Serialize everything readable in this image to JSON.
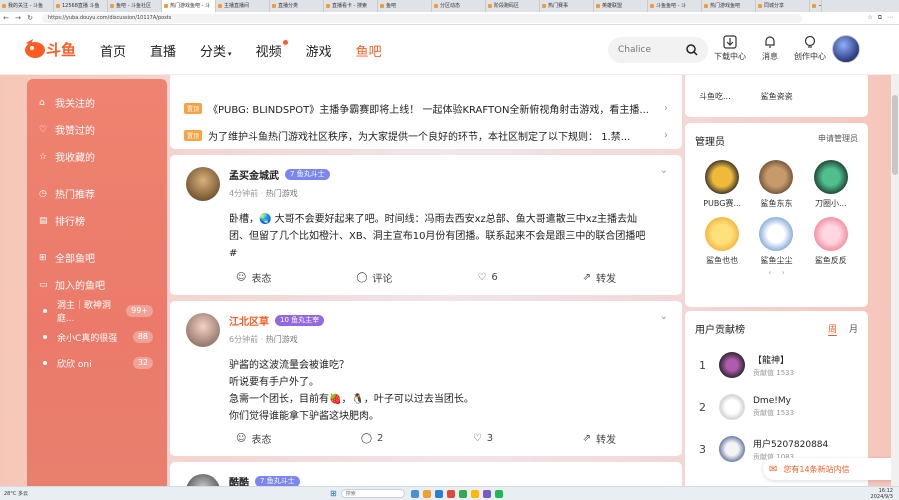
{
  "browser": {
    "tabs": [
      "我的关注 - 斗鱼",
      "12568直播 斗鱼",
      "鱼吧 - 斗鱼社区",
      "热门游戏鱼吧 - 斗",
      "主播直播间",
      "直播分类",
      "直播看卡 - 搜索",
      "鱼吧",
      "分区动态",
      "阶段跑码区",
      "热门赛事",
      "英雄联盟",
      "斗鱼鱼吧 - 斗",
      "热门游戏鱼吧",
      "同城分享"
    ],
    "url": "https://yuba.douyu.com/discussion/10117A/posts"
  },
  "header": {
    "nav": [
      "首页",
      "直播",
      "分类",
      "视频",
      "游戏",
      "鱼吧"
    ],
    "search_placeholder": "Chalice",
    "icons": [
      "下载中心",
      "消息",
      "创作中心"
    ]
  },
  "sidebar": {
    "items": [
      "我关注的",
      "我赞过的",
      "我收藏的",
      "热门推荐",
      "排行榜",
      "全部鱼吧",
      "加入的鱼吧"
    ],
    "clubs": [
      {
        "name": "洞主｜歌神洞庭...",
        "count": "99+"
      },
      {
        "name": "余小C真的很强",
        "count": "88"
      },
      {
        "name": "欣欣 oni",
        "count": "32"
      }
    ]
  },
  "notices": [
    {
      "tag": "置顶",
      "text": "《PUBG: BLINDSPOT》主播争霸赛即将上线！ 一起体验KRAFTON全新俯视角射击游戏，看主播..."
    },
    {
      "tag": "置顶",
      "text": "为了维护斗鱼热门游戏社区秩序，为大家提供一个良好的环节，本社区制定了以下规则： 1.禁..."
    }
  ],
  "posts": [
    {
      "user": "孟买金城武",
      "level": "7 鱼丸斗士",
      "time": "4分钟前",
      "section": "热门游戏",
      "lines": [
        "卧槽，🌏 大哥不会要好起来了吧。时间线：冯雨去西安xz总部、鱼大哥遣散三中xz主播去灿",
        "团、但留了几个比如橙汁、XB、洞主宣布10月份有团播。联系起来不会是跟三中的联合团播吧",
        "#"
      ],
      "actions": [
        "表态",
        "评论",
        "6",
        "转发"
      ]
    },
    {
      "user": "江北区草",
      "level": "10 鱼丸主宰",
      "time": "6分钟前",
      "section": "热门游戏",
      "lines": [
        "驴酱的这波流量会被谁吃？",
        "听说要有手户外了。",
        "急需一个团长，目前有🍓，🐧，叶子可以过去当团长。",
        "你们觉得谁能拿下驴酱这块肥肉。"
      ],
      "actions": [
        "表态",
        "2",
        "3",
        "转发"
      ]
    },
    {
      "user": "酷酷",
      "level": "7 鱼丸斗士"
    }
  ],
  "right": {
    "top_items": [
      "斗鱼吃...",
      "鲨鱼瓷瓷"
    ],
    "admin_title": "管理员",
    "admin_link": "申请管理员",
    "admins": [
      "PUBG赛...",
      "鲨鱼东东",
      "刀圈小...",
      "鲨鱼也也",
      "鲨鱼尘尘",
      "鲨鱼反反"
    ],
    "rank_title": "用户贡献榜",
    "rank_tabs": [
      "周",
      "月"
    ],
    "ranks": [
      {
        "n": "1",
        "name": "【龍神】",
        "label": "贡献值",
        "value": "1533"
      },
      {
        "n": "2",
        "name": "Dme!My",
        "label": "贡献值",
        "value": "1533"
      },
      {
        "n": "3",
        "name": "用户5207820884",
        "label": "贡献值",
        "value": "1083"
      }
    ]
  },
  "notification": "您有14条新站内信",
  "taskbar": {
    "weather": "28°C 多云",
    "search": "搜索",
    "time": "16:12",
    "date": "2024/9/3"
  }
}
